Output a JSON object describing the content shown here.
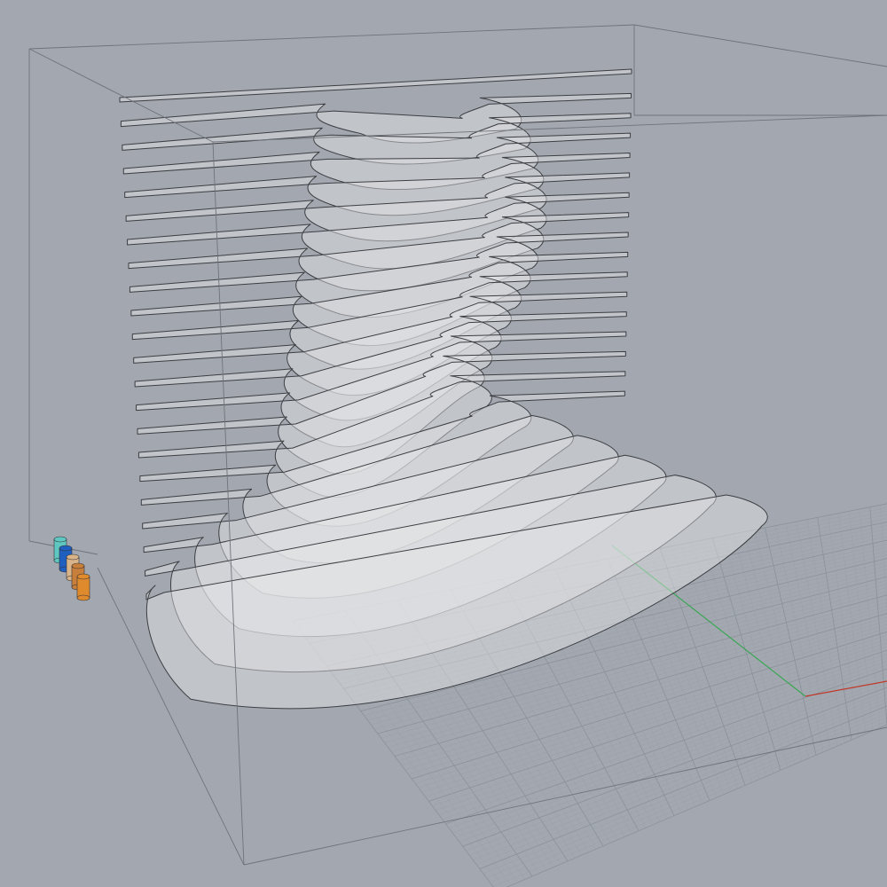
{
  "viewport": {
    "background_color": "#a3a8b0",
    "grid_fine_color": "#9aa0a8",
    "grid_major_color": "#8d939c",
    "bounding_box_color": "#6f747b",
    "slice_fill_color": "#e6e7e9",
    "slice_stroke_color": "#3c3e42",
    "axis_x_color": "#c0392b",
    "axis_y_color": "#3aa655",
    "slice_count": 22
  },
  "stack_widget": {
    "colors": [
      "#5fc7c1",
      "#1f5fbf",
      "#d9b48a",
      "#c87f3c",
      "#e08a2e"
    ]
  }
}
